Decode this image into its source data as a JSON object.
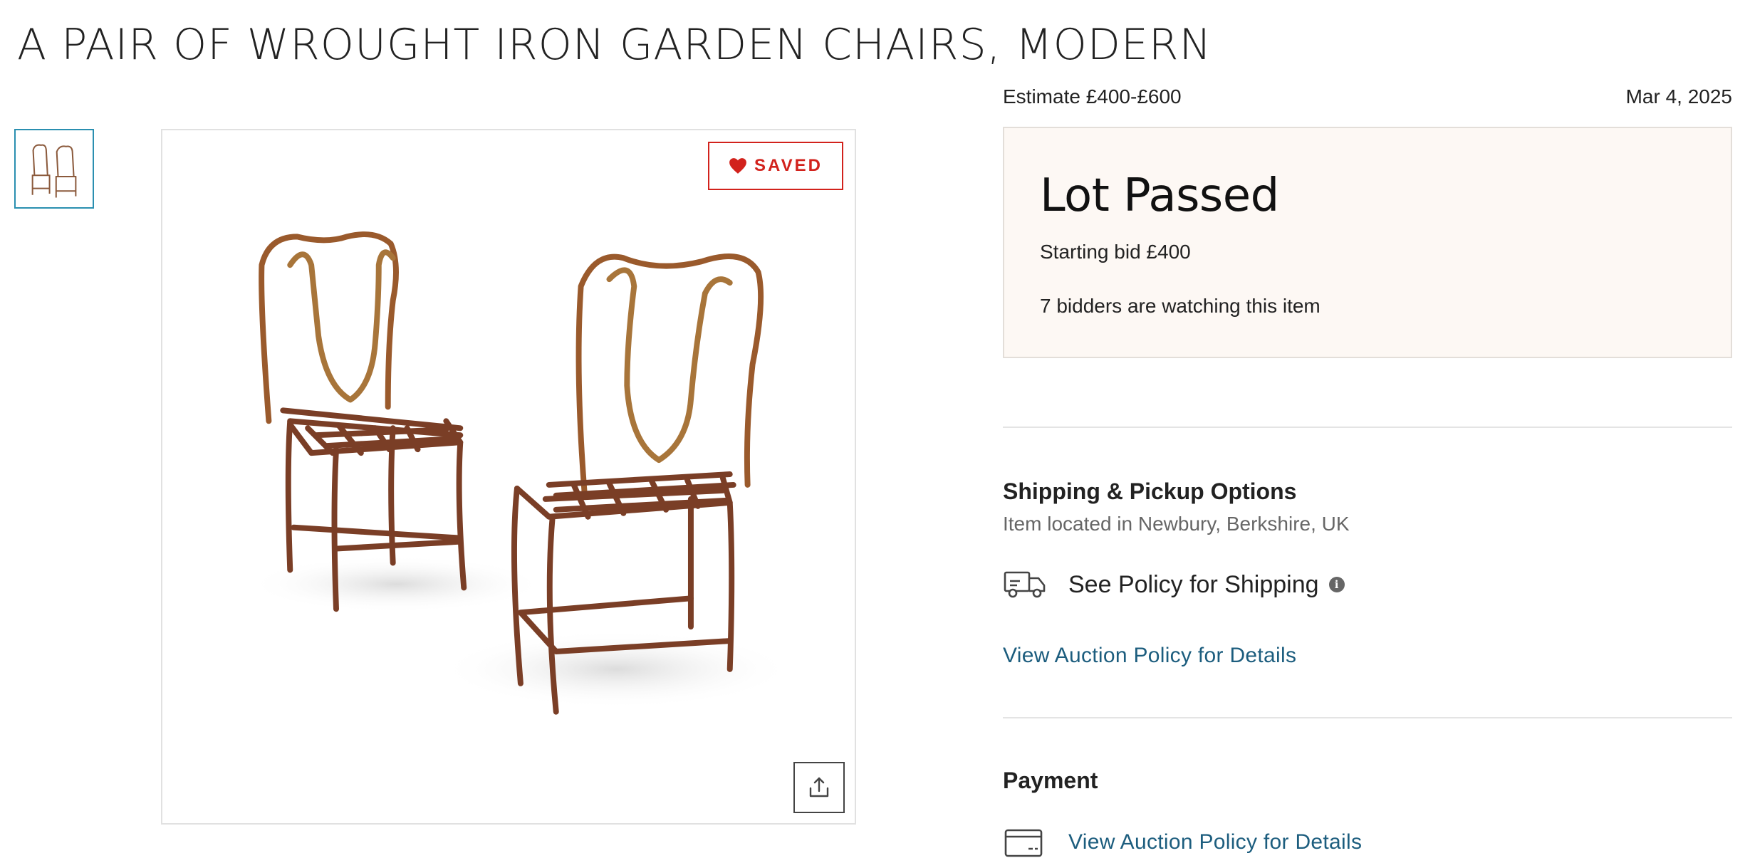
{
  "lot": {
    "title": "A PAIR OF WROUGHT IRON GARDEN CHAIRS, MODERN",
    "estimate": "Estimate £400-£600",
    "date": "Mar 4, 2025"
  },
  "gallery": {
    "saved_label": "SAVED",
    "thumbnail_count": 1
  },
  "status": {
    "title": "Lot Passed",
    "starting_bid": "Starting bid £400",
    "watchers": "7 bidders are watching this item"
  },
  "shipping": {
    "heading": "Shipping & Pickup Options",
    "location": "Item located in Newbury, Berkshire, UK",
    "policy_label": "See Policy for Shipping",
    "info_glyph": "i",
    "details_link": "View Auction Policy for Details",
    "icon": "truck-icon"
  },
  "payment": {
    "heading": "Payment",
    "details_link": "View Auction Policy for Details",
    "icon": "credit-card-icon"
  },
  "colors": {
    "saved_red": "#d2221c",
    "link_blue": "#1c5d7e",
    "status_bg": "#fdf8f4",
    "thumb_border": "#2a8fb0"
  }
}
